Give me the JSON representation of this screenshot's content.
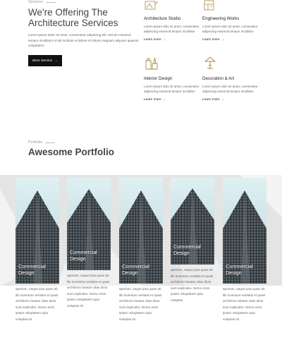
{
  "hero": {
    "eyebrow": "Services",
    "title": "We're Offering The Architecture Services",
    "text": "Lorem ipsum dolor sit amet, consectetur adipiscing elit, sed do eiusmod tempor incididunt ut lab incidunt ut labore et dolore magnam aliquam quaerat voluptatem.",
    "button_label": "More Service",
    "button_arrow": "→"
  },
  "services": [
    {
      "icon": "architecture-studio-icon",
      "title": "Architecture Studio",
      "text": "Lorem ipsum dolo sit amet, consectetur adipiscing eiusmod tempor incididun",
      "link": "Learn more",
      "arrow": "→"
    },
    {
      "icon": "engineering-works-icon",
      "title": "Engineering Works",
      "text": "Lorem ipsum dolo sit amet, consectetur adipiscing eiusmod tempor incididun",
      "link": "Learn more",
      "arrow": "→"
    },
    {
      "icon": "interior-design-icon",
      "title": "Interior Design",
      "text": "Lorem ipsum dolo sit amet, consectetur adipiscing eiusmod tempor incididun",
      "link": "Learn more",
      "arrow": "→"
    },
    {
      "icon": "decoration-art-icon",
      "title": "Decoration & Art",
      "text": "Lorem ipsum dolo sit amet, consectetur adipiscing eiusmod tempor incididun",
      "link": "Learn more",
      "arrow": "→"
    }
  ],
  "portfolio": {
    "eyebrow": "Portfolio",
    "title": "Awesome Portfolio",
    "cards": [
      {
        "title_line1": "Commercial",
        "title_line2": "Design",
        "text": "aperiam, eaque ipsa quae ab illo inventore veritatis et quasi architecto beatae vitae dicta sunt explicabo. Nemo enim ipsam voluptatem quia voluptas sit"
      },
      {
        "title_line1": "Commercial",
        "title_line2": "Design",
        "text": "aperiam, eaque ipsa quae ab illo inventore veritatis et quasi architecto beatae vitae dicta sunt explicabo. Nemo enim ipsam voluptatem quia voluptas sit"
      },
      {
        "title_line1": "Commercial",
        "title_line2": "Design",
        "text": "aperiam, eaque ipsa quae ab illo inventore veritatis et quasi architecto beatae vitae dicta sunt explicabo. Nemo enim ipsam voluptatem quia voluptas sit"
      },
      {
        "title_line1": "Commercial",
        "title_line2": "Design",
        "text": "aperiam, eaque ipsa quae ab illo inventore veritatis et quasi architecto beatae vitae dicta sunt explicabo. Nemo enim ipsam voluptatem quia voluptas"
      },
      {
        "title_line1": "Commercial",
        "title_line2": "Design",
        "text": "aperiam, eaque ipsa quae ab illo inventore veritatis et quasi architecto beatae vitae dicta sunt explicabo. Nemo enim ipsam voluptatem quia voluptas sit"
      }
    ]
  },
  "colors": {
    "accent": "#111111",
    "band": "#e4e4e4",
    "icon": "#a8864a"
  }
}
